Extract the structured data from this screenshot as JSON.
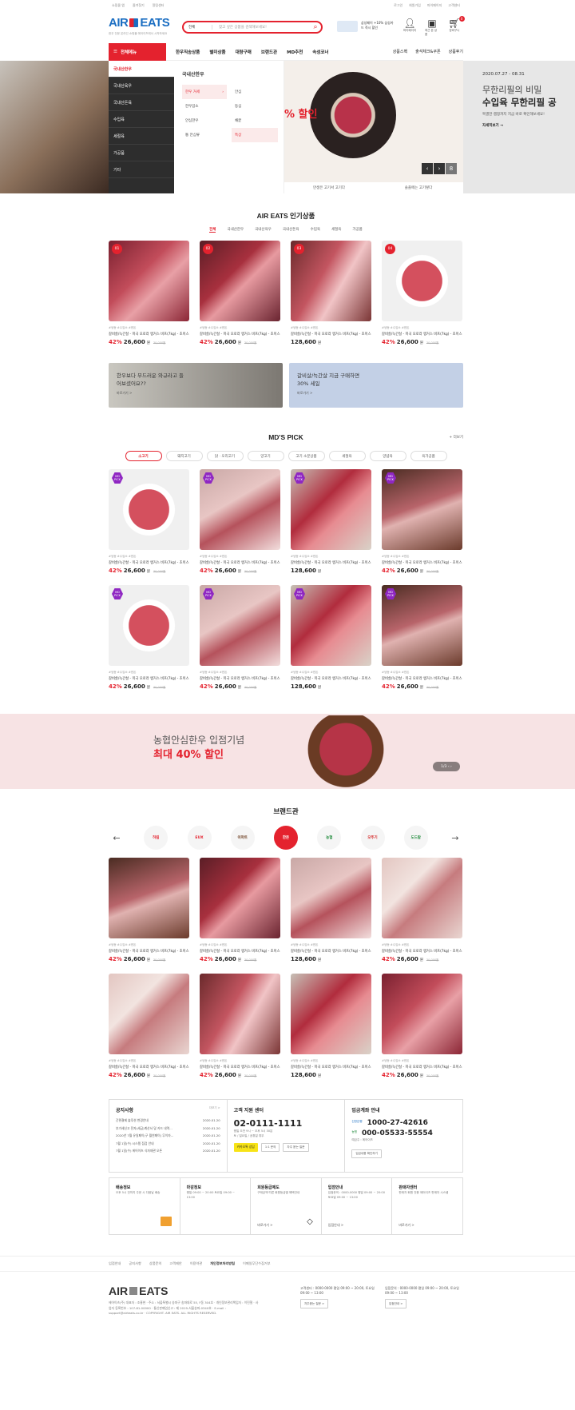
{
  "topbar": {
    "left": [
      "쇼핑몰 앱",
      "즐겨찾기",
      "알림센터"
    ],
    "right": [
      "로그인",
      "회원가입",
      "마이페이지",
      "고객센터"
    ]
  },
  "header": {
    "logo_air": "AIR",
    "logo_eats": "EATS",
    "logo_sub": "한우 전문 온라인 쇼핑몰 에어이츠에서 시작하세요",
    "search_select": "전체",
    "search_placeholder": "찾고 싶은 상품을 검색해보세요!",
    "promo_text": "삼성페이 +10% 삼성카드 즉시 할인",
    "icons": [
      {
        "label": "마이페이지"
      },
      {
        "label": "최근 본 상품"
      },
      {
        "label": "장바구니",
        "badge": "0"
      }
    ]
  },
  "gnb": {
    "all": "전체메뉴",
    "menu": [
      "한우직송상품",
      "별미상품",
      "대량구매",
      "브랜드관",
      "MD추천",
      "속성코너"
    ],
    "right": [
      "상품스펙",
      "출석체크&쿠폰",
      "상품후기"
    ]
  },
  "lnb": {
    "items": [
      "국내산한우",
      "국내산육우",
      "국내산돈육",
      "수입육",
      "세절육",
      "가공품",
      "기타"
    ]
  },
  "submenu": {
    "title": "국내산한우",
    "col1": [
      "한우 거세",
      "한우암소",
      "안심한우",
      "통 안심류"
    ],
    "col2": [
      "안심",
      "등심",
      "채끝",
      "특상"
    ]
  },
  "hero": {
    "sale": "% 할인",
    "date": "2020.07.27 - 08.31",
    "h1": "무한리필의 비밀",
    "h2": "수입육 무한리필 공",
    "sub": "특별한 캠핑까지 지금 바로 확인해보세요!",
    "more": "자세히보기 →",
    "tabs": [
      "만생은 고기서 고기다",
      "솔플에는 고기렇다"
    ],
    "pager": "8"
  },
  "popular": {
    "title": "AIR EATS 인기상품",
    "cats": [
      "전체",
      "국내산한우",
      "국내산육우",
      "국내산돈육",
      "수입육",
      "세절육",
      "가공품"
    ]
  },
  "product": {
    "tags": "#냉동 #수입소 #한돈",
    "name": "갈비살/늑간살 - 미국 오로라 앵거스 비프(7kg) - 초이스",
    "pct": "42%",
    "price": "26,600",
    "won": "원",
    "old": "30,000원",
    "price2": "128,600"
  },
  "promo_banners": [
    {
      "title": "한우보다 부드러운 와규라고 들어보셨어요??",
      "link": "바로가기 >"
    },
    {
      "title": "갈비살/늑간살 지금 구매하면 30% 세일",
      "link": "바로가기 >"
    }
  ],
  "md": {
    "title": "MD'S PICK",
    "more": "+ 더보기",
    "pills": [
      "소고기",
      "돼지고기",
      "닭 · 오리고기",
      "양고기",
      "고기 소분상품",
      "세절육",
      "양념육",
      "육가공품"
    ],
    "badge": "MD PICK"
  },
  "wide": {
    "t1": "농협안심한우 입점기념",
    "t2": "최대 40% 할인",
    "pager": "1/3 ‹ ›"
  },
  "brand": {
    "title": "브랜드관",
    "items": [
      "하림",
      "EUX",
      "이마트",
      "한돈",
      "농협",
      "오뚜기",
      "도드람"
    ]
  },
  "notice": {
    "title": "공지사항",
    "more": "더보기 >",
    "items": [
      {
        "t": "간편결제 솔루션 변경안내",
        "d": "2020.01.20"
      },
      {
        "t": "부가세신고 전자(세금)계산서 및 카드 내역...",
        "d": "2020.01.20"
      },
      {
        "t": "2020년 7월 유일페이(구 월연페이) 무이자...",
        "d": "2020.01.20"
      },
      {
        "t": "7월 1일(수) 시스템 점검 안내",
        "d": "2020.01.20"
      },
      {
        "t": "7월 1일(수) 에어이츠 식자재관 오픈",
        "d": "2020.01.20"
      }
    ]
  },
  "cs": {
    "title": "고객 지원 센터",
    "tel": "02-0111-1111",
    "hours": "평일 오전 9시 ~ 오후 5시 30분",
    "off": "토 / 일요일 / 공휴일 휴무",
    "kakao": "카카오톡 상담",
    "b1": "1:1 문의",
    "b2": "자주 묻는 질문"
  },
  "bank": {
    "title": "입금계좌 안내",
    "b1": "신한은행",
    "n1": "1000-27-42616",
    "b2": "농협",
    "n2": "000-05533-55554",
    "holder": "예금주 : 에어이츠",
    "btn": "입금내용 확인하기"
  },
  "services": [
    {
      "h": "배송정보",
      "s": "오후 5시 전까지 주문 시 다음날 배송",
      "l": ""
    },
    {
      "h": "마감정보",
      "s": "평일 09:00 ~ 20:00 토요일 09:00 ~ 13:00",
      "l": ""
    },
    {
      "h": "회원등급제도",
      "s": "구매금액 따른 회원등급별 혜택안내",
      "l": "바로가기 >"
    },
    {
      "h": "입점안내",
      "s": "입점문의 : 0000-0000 평일 09:00 ~ 20:00 토요일 09:00 ~ 13:00",
      "l": "입점안내 >"
    },
    {
      "h": "판매자센터",
      "s": "판매자 회원 전용 에어이츠 판매자 시스템",
      "l": "바로가기 >"
    }
  ],
  "fnav": [
    "입점안내",
    "공지사항",
    "상품문의",
    "고객제안",
    "이용약관",
    "개인정보처리방침",
    "이메일무단수집거부"
  ],
  "footer": {
    "company": "에어이츠(주) 대표자 : 조흥현 · 주소 : 서울특별시 송파구 송파대로 55, F동 304호 · 개인정보관리책임자 : 이민철 · 사업자 등록번호 : 107-81-00000 · 통신판매업신고 : 제 2019-서울송파-0340호 · E-mail : support@airteats.co.kr · COPYRIGHT. AIR EATS. ALL RIGHTS RESERVED.",
    "cs": "고객센터 : 0000-0000 평일 09:00 ~ 20:00, 토요일 09:00 ~ 13:00",
    "cs_btn": "자주묻는 질문 >",
    "inq": "입점문의 : 0000-0000 평일 09:00 ~ 20:00, 토요일 09:00 ~ 13:00",
    "inq_btn": "입점안내 >"
  },
  "colors": {
    "accent": "#e4222e",
    "brand_blue": "#1b6ec2",
    "md_purple": "#8f27c2"
  }
}
